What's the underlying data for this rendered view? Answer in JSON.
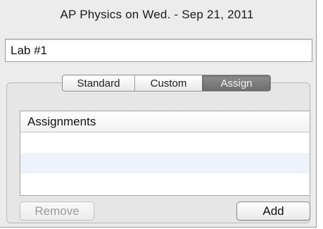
{
  "window": {
    "title": "AP Physics on Wed. - Sep 21, 2011"
  },
  "name_field": {
    "value": "Lab #1"
  },
  "tabs": [
    {
      "label": "Standard",
      "selected": false
    },
    {
      "label": "Custom",
      "selected": false
    },
    {
      "label": "Assign",
      "selected": true
    }
  ],
  "assignments_table": {
    "header": "Assignments",
    "rows": []
  },
  "buttons": {
    "remove_label": "Remove",
    "add_label": "Add"
  },
  "colors": {
    "panel_bg": "#ececec",
    "selected_tab": "#7d7d7d",
    "alt_row": "#eef3fb"
  }
}
